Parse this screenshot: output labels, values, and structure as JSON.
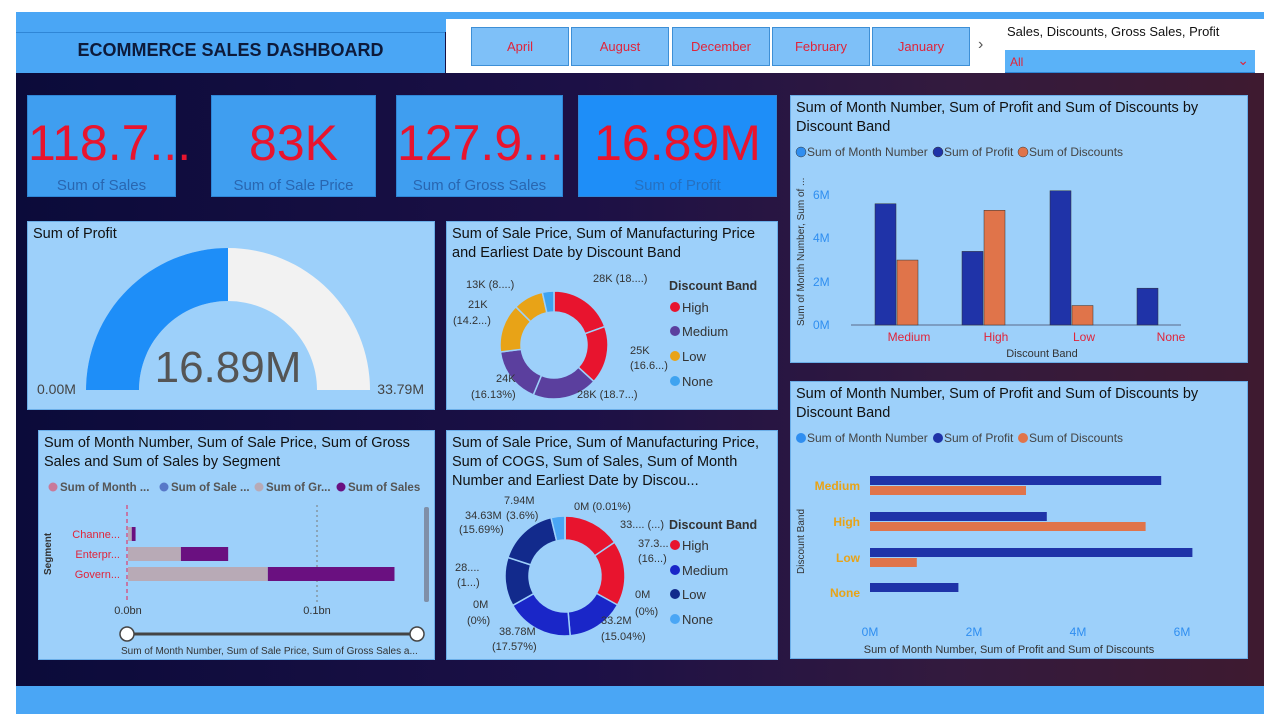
{
  "header": {
    "title": "ECOMMERCE SALES DASHBOARD",
    "months": [
      "April",
      "August",
      "December",
      "February",
      "January"
    ],
    "more_icon": "chevron-right-icon",
    "measure_label": "Sales, Discounts, Gross Sales, Profit",
    "measure_value": "All",
    "dropdown_icon": "chevron-down-icon"
  },
  "kpis": [
    {
      "value": "118.7...",
      "label": "Sum of  Sales"
    },
    {
      "value": "83K",
      "label": "Sum of Sale Price"
    },
    {
      "value": "127.9...",
      "label": "Sum of Gross Sales"
    },
    {
      "value": "16.89M",
      "label": "Sum of Profit"
    }
  ],
  "gauge": {
    "title": "Sum of Profit",
    "value": "16.89M",
    "min": "0.00M",
    "max": "33.79M",
    "fraction": 0.5
  },
  "donut1": {
    "title": "Sum of Sale Price, Sum of Manufacturing Price and Earliest Date by Discount Band",
    "legend_title": "Discount Band",
    "legend": [
      "High",
      "Medium",
      "Low",
      "None"
    ],
    "labels": [
      "28K (18....)",
      "25K",
      "(16.6...)",
      "28K (18.7...)",
      "24K",
      "(16.13%)",
      "21K",
      "(14.2...)",
      "13K (8....)"
    ]
  },
  "donut2": {
    "title": "Sum of Sale Price, Sum of Manufacturing Price, Sum of COGS, Sum of Sales, Sum of Month Number and Earliest Date by Discou...",
    "legend_title": "Discount Band",
    "legend": [
      "High",
      "Medium",
      "Low",
      "None"
    ],
    "labels": [
      "0M (0.01%)",
      "33.... (...)",
      "37.3...",
      "(16...)",
      "0M",
      "(0%)",
      "33.2M",
      "(15.04%)",
      "38.78M",
      "(17.57%)",
      "0M",
      "(0%)",
      "28....",
      "(1...)",
      "34.63M",
      "(15.69%)",
      "7.94M",
      "(3.6%)"
    ]
  },
  "segment_chart": {
    "title": "Sum of Month Number, Sum of Sale Price, Sum of Gross Sales and Sum of Sales by Segment",
    "legend": [
      "Sum of Month ...",
      "Sum of Sale ...",
      "Sum of Gr...",
      "Sum of  Sales"
    ],
    "ylabel": "Segment",
    "categories": [
      "Channe...",
      "Enterpr...",
      "Govern..."
    ],
    "ticks": [
      "0.0bn",
      "0.1bn"
    ],
    "xlabel": "Sum of Month Number, Sum of Sale Price, Sum of Gross Sales a..."
  },
  "col_chart": {
    "title": "Sum of Month Number, Sum of Profit and Sum of Discounts by Discount Band",
    "legend": [
      "Sum of Month Number",
      "Sum of Profit",
      "Sum of Discounts"
    ],
    "ylabel": "Sum of Month Number, Sum of ...",
    "xlabel": "Discount Band",
    "yticks": [
      "0M",
      "2M",
      "4M",
      "6M"
    ]
  },
  "bar_chart": {
    "title": "Sum of Month Number, Sum of Profit and Sum of Discounts by Discount Band",
    "legend": [
      "Sum of Month Number",
      "Sum of Profit",
      "Sum of Discounts"
    ],
    "ylabel": "Discount Band",
    "xlabel": "Sum of Month Number, Sum of Profit and Sum of Discounts",
    "xticks": [
      "0M",
      "2M",
      "4M",
      "6M"
    ]
  },
  "colors": {
    "high": "#e8142e",
    "medium": "#5b3f9e",
    "low": "#e8a317",
    "none": "#3fa3f0",
    "month": "#2f8ef0",
    "profit": "#1f33a8",
    "discounts": "#e0744a",
    "d2_medium": "#1a26c8",
    "d2_low": "#122a8c",
    "d2_none": "#4aa6f5",
    "seg_month": "#c97a9a",
    "seg_sale": "#5878c8",
    "seg_gross": "#b8aab6",
    "seg_sales": "#6a1080"
  },
  "chart_data": [
    {
      "type": "bar",
      "title": "Sum of Month Number, Sum of Profit and Sum of Discounts by Discount Band",
      "categories": [
        "Medium",
        "High",
        "Low",
        "None"
      ],
      "xlabel": "Discount Band",
      "ylabel": "Sum of Month Number, Sum of ...",
      "ylim": [
        0,
        6.5
      ],
      "series": [
        {
          "name": "Sum of Month Number",
          "values": [
            0,
            0,
            0,
            0
          ]
        },
        {
          "name": "Sum of Profit",
          "values": [
            5.6,
            3.4,
            6.2,
            1.7
          ]
        },
        {
          "name": "Sum of Discounts",
          "values": [
            3.0,
            5.3,
            0.9,
            0
          ]
        }
      ]
    },
    {
      "type": "bar",
      "orientation": "horizontal",
      "title": "Sum of Month Number, Sum of Profit and Sum of Discounts by Discount Band",
      "categories": [
        "Medium",
        "High",
        "Low",
        "None"
      ],
      "xlabel": "Sum of Month Number, Sum of Profit and Sum of Discounts",
      "ylabel": "Discount Band",
      "xlim": [
        0,
        6.5
      ],
      "series": [
        {
          "name": "Sum of Month Number",
          "values": [
            0,
            0,
            0,
            0
          ]
        },
        {
          "name": "Sum of Profit",
          "values": [
            5.6,
            3.4,
            6.2,
            1.7
          ]
        },
        {
          "name": "Sum of Discounts",
          "values": [
            3.0,
            5.3,
            0.9,
            0
          ]
        }
      ]
    },
    {
      "type": "pie",
      "title": "Sum of Sale Price, Sum of Manufacturing Price and Earliest Date by Discount Band",
      "categories": [
        "High",
        "High",
        "Medium",
        "Medium",
        "Low",
        "Low",
        "None"
      ],
      "values": [
        28,
        25,
        28,
        24,
        21,
        13,
        5
      ]
    },
    {
      "type": "pie",
      "title": "Sum of Sale Price, Sum of Manufacturing Price, Sum of COGS, Sum of Sales, Sum of Month Number and Earliest Date by Discou...",
      "categories": [
        "High",
        "High",
        "Medium",
        "Medium",
        "Low",
        "Low",
        "None",
        "None"
      ],
      "values": [
        33,
        37.3,
        33.2,
        38.78,
        28,
        34.63,
        7.94,
        0.01
      ]
    },
    {
      "type": "bar",
      "orientation": "horizontal",
      "stacked": true,
      "title": "Sum of Month Number, Sum of Sale Price, Sum of Gross Sales and Sum of Sales by Segment",
      "categories": [
        "Channe...",
        "Enterpr...",
        "Govern..."
      ],
      "xlim": [
        0,
        0.15
      ],
      "series": [
        {
          "name": "Sum of Month ...",
          "values": [
            0,
            0,
            0
          ]
        },
        {
          "name": "Sum of Sale ...",
          "values": [
            0,
            0,
            0
          ]
        },
        {
          "name": "Sum of Gr...",
          "values": [
            0.002,
            0.028,
            0.074
          ]
        },
        {
          "name": "Sum of  Sales",
          "values": [
            0.002,
            0.025,
            0.067
          ]
        }
      ]
    }
  ]
}
